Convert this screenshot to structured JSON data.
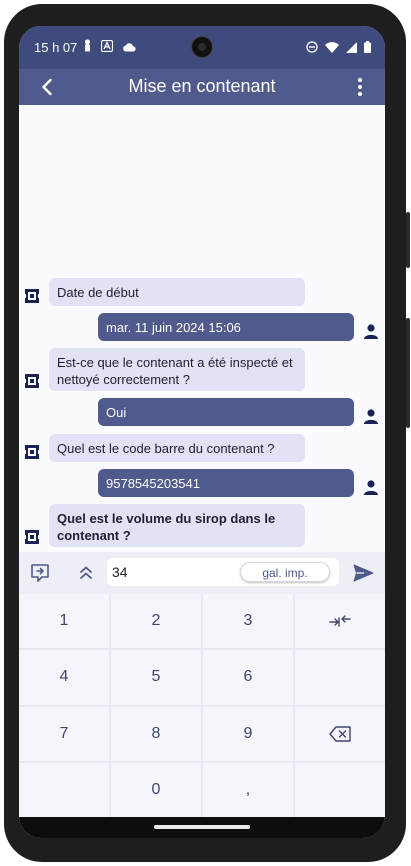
{
  "status": {
    "time": "15 h 07",
    "icons": [
      "person-icon",
      "a-box-icon",
      "cloud-icon",
      "dnd-icon",
      "wifi-icon",
      "signal-icon",
      "battery-icon"
    ]
  },
  "appbar": {
    "title": "Mise en contenant",
    "back_icon": "back-arrow-icon",
    "menu_icon": "more-vertical-icon"
  },
  "chat": {
    "messages": [
      {
        "sender": "bot",
        "text": "Date de début"
      },
      {
        "sender": "user",
        "text": "mar. 11 juin 2024 15:06"
      },
      {
        "sender": "bot",
        "text": "Est-ce que le contenant a été inspecté et nettoyé correctement ?"
      },
      {
        "sender": "user",
        "text": "Oui"
      },
      {
        "sender": "bot",
        "text": "Quel est le code barre du contenant ?"
      },
      {
        "sender": "user",
        "text": "9578545203541"
      },
      {
        "sender": "bot",
        "text": "Quel est le volume du sirop dans le contenant ?"
      }
    ]
  },
  "inputbar": {
    "value": "34",
    "chip_label": "gal. imp."
  },
  "keypad": {
    "keys": [
      "1",
      "2",
      "3",
      "",
      "4",
      "5",
      "6",
      "",
      "7",
      "8",
      "9",
      "",
      "",
      "0",
      ",",
      ""
    ]
  },
  "colors": {
    "primary": "#505a8c",
    "status_bar": "#3f4a7d",
    "bot_bubble": "#e2e2f6",
    "user_bubble": "#505a8c",
    "background": "#fbfaff"
  }
}
